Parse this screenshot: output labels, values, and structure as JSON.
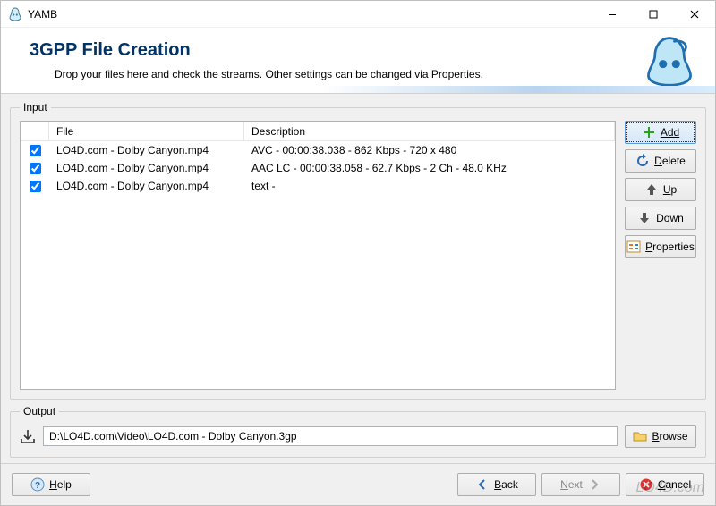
{
  "window": {
    "title": "YAMB"
  },
  "header": {
    "title": "3GPP File Creation",
    "subtitle": "Drop your files here and check the streams. Other settings can be changed via Properties."
  },
  "input": {
    "legend": "Input",
    "columns": {
      "file": "File",
      "description": "Description"
    },
    "rows": [
      {
        "checked": true,
        "file": "LO4D.com - Dolby Canyon.mp4",
        "description": "AVC - 00:00:38.038 - 862 Kbps - 720 x 480"
      },
      {
        "checked": true,
        "file": "LO4D.com - Dolby Canyon.mp4",
        "description": "AAC LC - 00:00:38.058 - 62.7 Kbps - 2 Ch - 48.0 KHz"
      },
      {
        "checked": true,
        "file": "LO4D.com - Dolby Canyon.mp4",
        "description": "text -"
      }
    ]
  },
  "side_buttons": {
    "add": "Add",
    "delete": "Delete",
    "up": "Up",
    "down": "Down",
    "properties": "Properties"
  },
  "output": {
    "legend": "Output",
    "path": "D:\\LO4D.com\\Video\\LO4D.com - Dolby Canyon.3gp",
    "browse": "Browse"
  },
  "footer": {
    "help": "Help",
    "back": "Back",
    "next": "Next",
    "cancel": "Cancel"
  },
  "watermark": "LO4D.com"
}
